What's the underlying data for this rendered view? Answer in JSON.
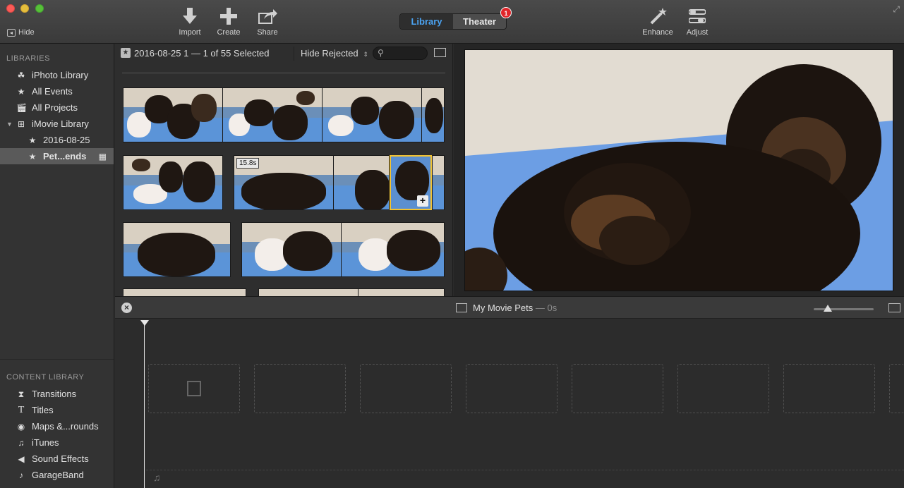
{
  "toolbar": {
    "hide_label": "Hide",
    "import_label": "Import",
    "create_label": "Create",
    "share_label": "Share",
    "enhance_label": "Enhance",
    "adjust_label": "Adjust",
    "segment": {
      "library": "Library",
      "theater": "Theater",
      "theater_badge": "1"
    }
  },
  "sidebar": {
    "libraries_heading": "LIBRARIES",
    "items": [
      {
        "label": "iPhoto Library",
        "icon": "palm-tree-icon"
      },
      {
        "label": "All Events",
        "icon": "star-icon"
      },
      {
        "label": "All Projects",
        "icon": "clapper-icon"
      },
      {
        "label": "iMovie Library",
        "icon": "grid-icon"
      },
      {
        "label": "2016-08-25",
        "icon": "star-icon"
      },
      {
        "label": "Pet...ends",
        "icon": "star-icon"
      }
    ],
    "content_heading": "CONTENT LIBRARY",
    "content_items": [
      {
        "label": "Transitions",
        "icon": "transitions-icon"
      },
      {
        "label": "Titles",
        "icon": "titles-icon"
      },
      {
        "label": "Maps &...rounds",
        "icon": "globe-icon"
      },
      {
        "label": "iTunes",
        "icon": "music-note-icon"
      },
      {
        "label": "Sound Effects",
        "icon": "speaker-icon"
      },
      {
        "label": "GarageBand",
        "icon": "guitar-icon"
      }
    ]
  },
  "browser": {
    "event_title": "2016-08-25 1 — 1 of 55 Selected",
    "filter": "Hide Rejected",
    "clip_duration": "15.8s"
  },
  "timeline": {
    "project_title": "My Movie Pets",
    "project_duration": "— 0s"
  },
  "colors": {
    "accent": "#4ba3f2",
    "selection": "#f1c232",
    "badge": "#e0262a"
  }
}
